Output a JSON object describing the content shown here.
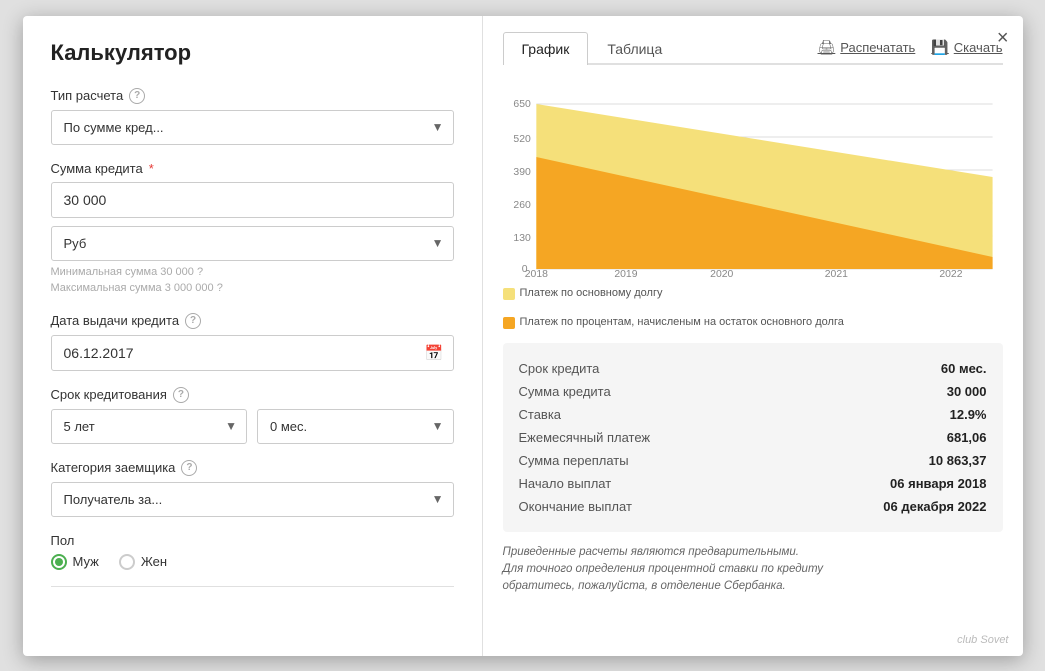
{
  "modal": {
    "title": "Калькулятор",
    "close_label": "×"
  },
  "left": {
    "calc_type_label": "Тип расчета",
    "calc_type_value": "По сумме кред...",
    "credit_sum_label": "Сумма кредита",
    "credit_sum_required": "*",
    "credit_sum_value": "30 000",
    "currency_value": "Руб",
    "hint_min": "Минимальная сумма 30 000",
    "hint_max": "Максимальная сумма 3 000 000",
    "date_label": "Дата выдачи кредита",
    "date_value": "06.12.2017",
    "term_label": "Срок кредитования",
    "term_years_value": "5 лет",
    "term_months_value": "0 мес.",
    "category_label": "Категория заемщика",
    "category_value": "Получатель за...",
    "gender_label": "Пол",
    "gender_male": "Муж",
    "gender_female": "Жен"
  },
  "right": {
    "tab_chart": "График",
    "tab_table": "Таблица",
    "btn_print": "Распечатать",
    "btn_download": "Скачать",
    "chart": {
      "y_labels": [
        "0",
        "130",
        "260",
        "390",
        "520",
        "650"
      ],
      "x_labels": [
        "2018",
        "2019",
        "2020",
        "2021",
        "2022"
      ],
      "color_principal": "#f5e07a",
      "color_interest": "#f5a623"
    },
    "legend": [
      {
        "label": "Платеж по основному долгу",
        "color": "#f5e07a"
      },
      {
        "label": "Платеж по процентам, начисленым на остаток основного долга",
        "color": "#f5a623"
      }
    ],
    "summary": {
      "rows": [
        {
          "label": "Срок кредита",
          "value": "60 мес."
        },
        {
          "label": "Сумма кредита",
          "value": "30 000"
        },
        {
          "label": "Ставка",
          "value": "12.9%"
        },
        {
          "label": "Ежемесячный платеж",
          "value": "681,06"
        },
        {
          "label": "Сумма переплаты",
          "value": "10 863,37"
        },
        {
          "label": "Начало выплат",
          "value": "06 января 2018"
        },
        {
          "label": "Окончание выплат",
          "value": "06 декабря 2022"
        }
      ]
    },
    "disclaimer": "Приведенные расчеты являются предварительными.\nДля точного определения процентной ставки по кредиту\nобратитесь, пожалуйста, в отделение Сбербанка.",
    "watermark": "club\nSovet"
  }
}
